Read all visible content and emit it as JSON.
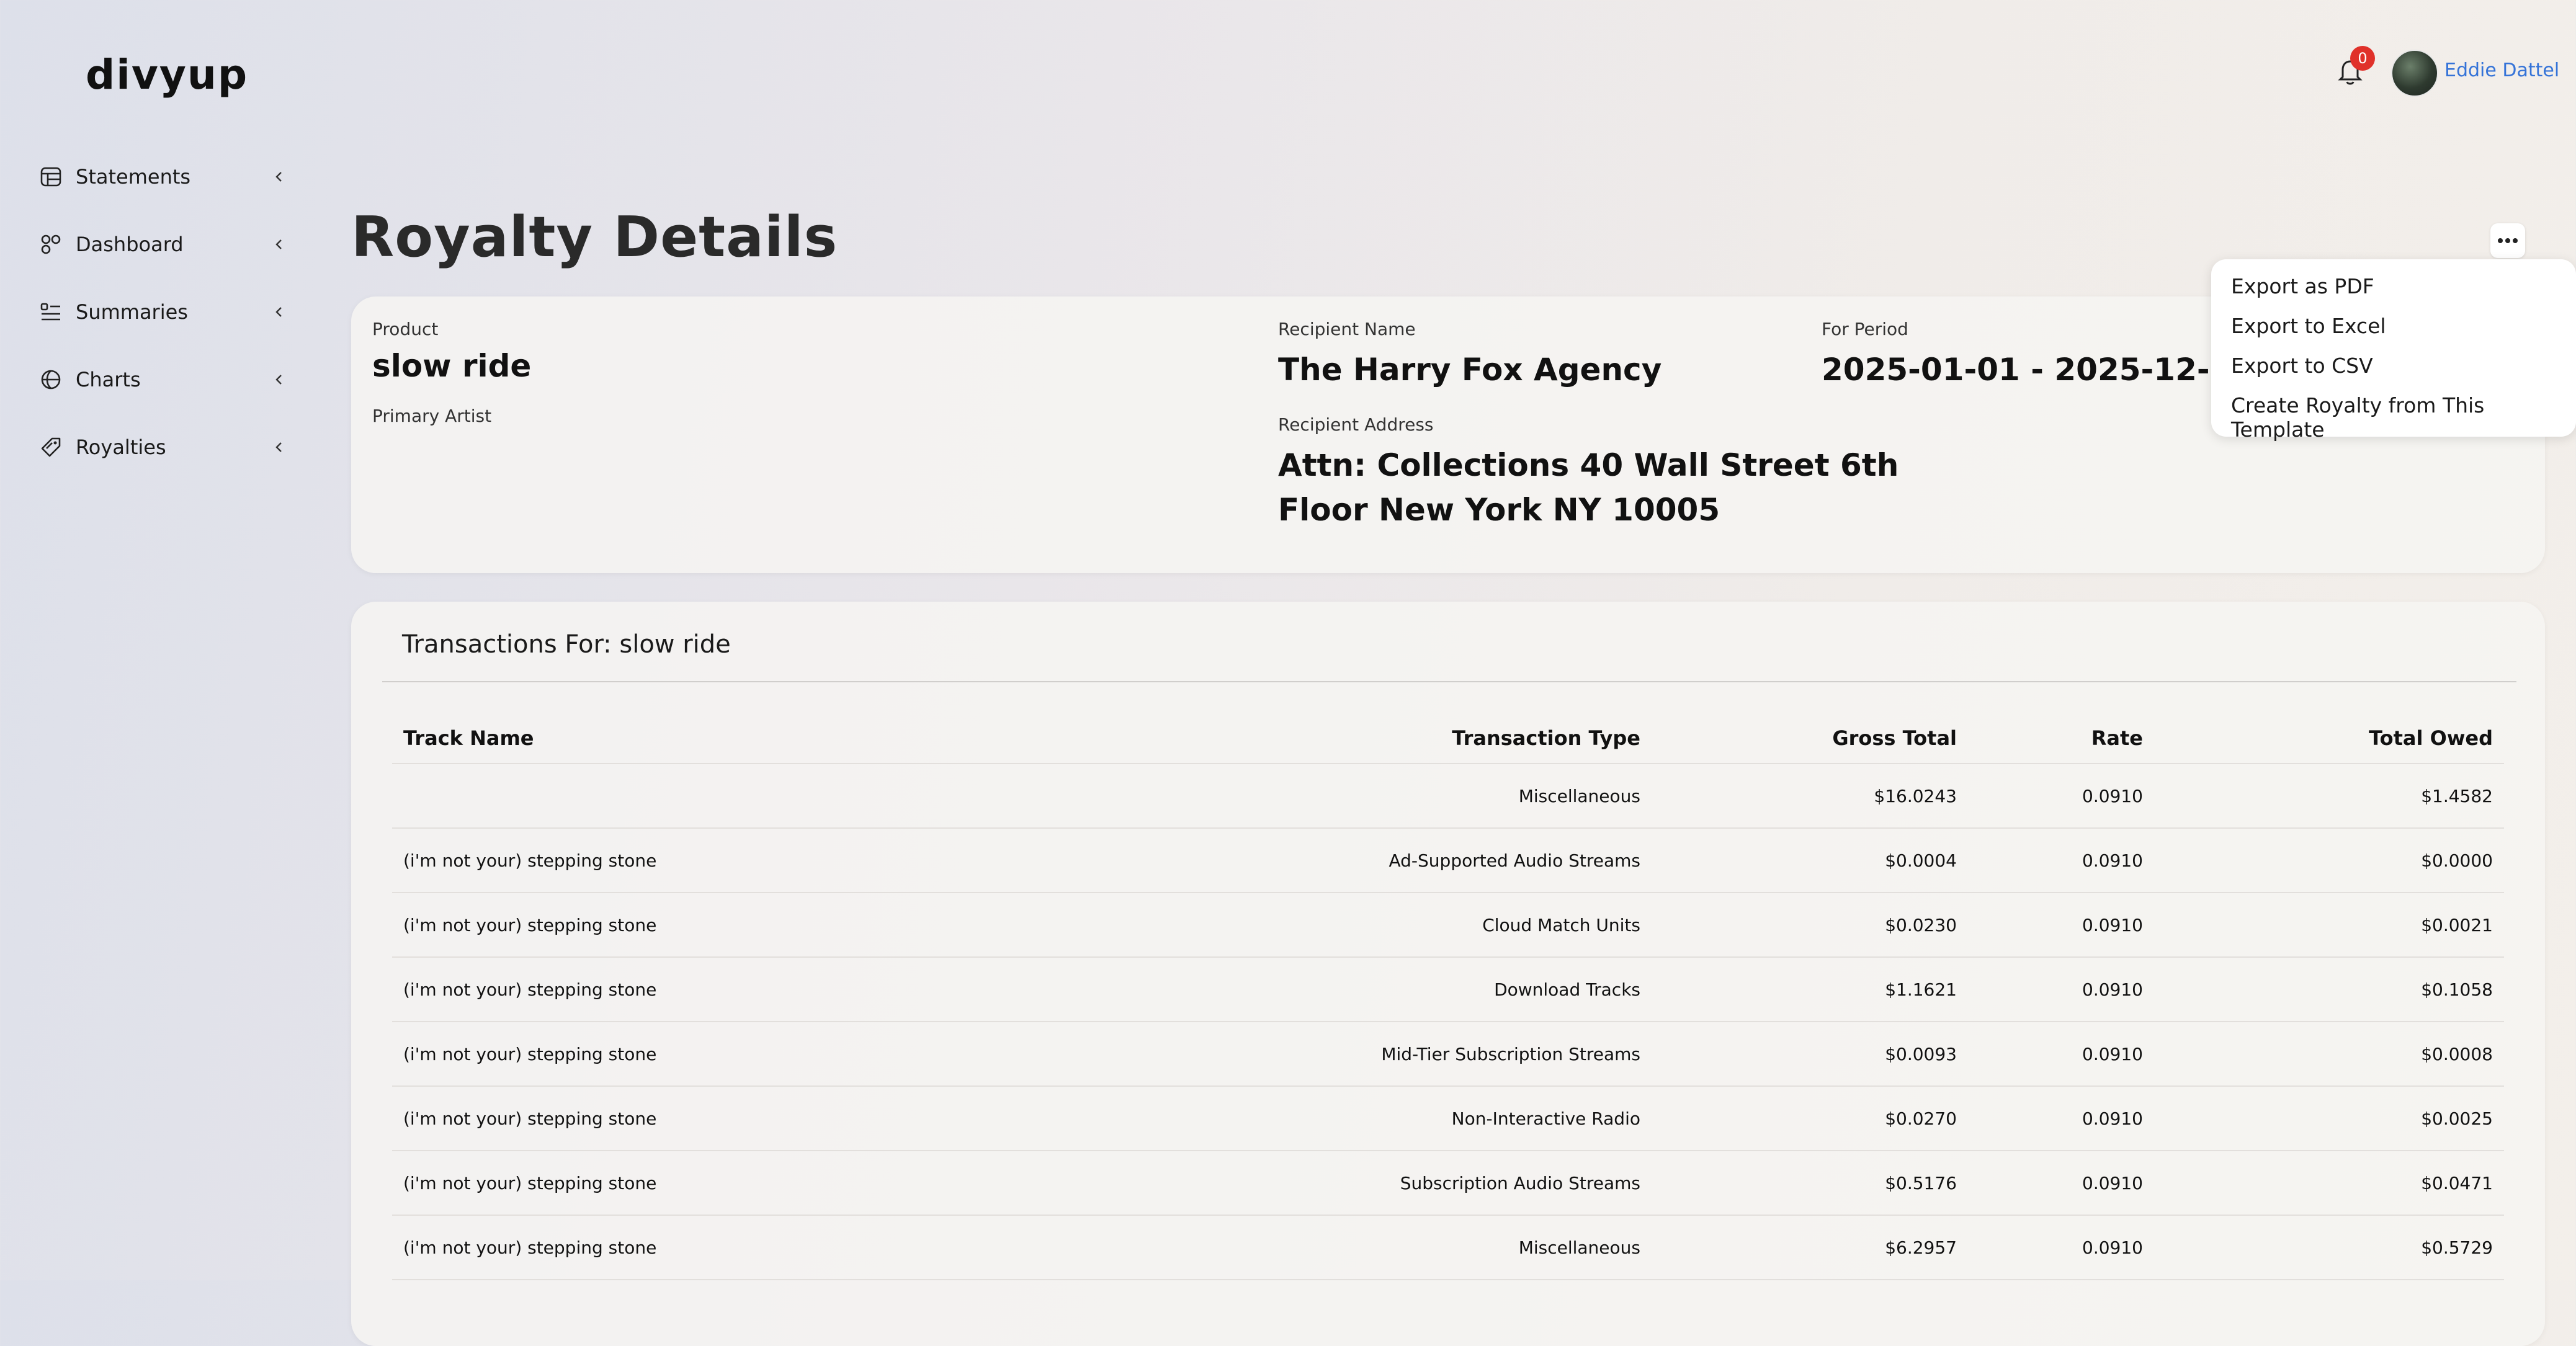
{
  "brand": {
    "logo": "divyup"
  },
  "sidebar": {
    "items": [
      {
        "label": "Statements",
        "icon": "table-icon"
      },
      {
        "label": "Dashboard",
        "icon": "dashboard-icon"
      },
      {
        "label": "Summaries",
        "icon": "list-icon"
      },
      {
        "label": "Charts",
        "icon": "globe-chart-icon"
      },
      {
        "label": "Royalties",
        "icon": "tag-icon"
      }
    ]
  },
  "header": {
    "notifications_count": "0",
    "user_name": "Eddie Dattel"
  },
  "page": {
    "title": "Royalty Details"
  },
  "menu": {
    "items": [
      "Export as PDF",
      "Export to Excel",
      "Export to CSV",
      "Create Royalty from This Template"
    ]
  },
  "details": {
    "product_label": "Product",
    "product_value": "slow ride",
    "primary_artist_label": "Primary Artist",
    "recipient_name_label": "Recipient Name",
    "recipient_name_value": "The Harry Fox Agency",
    "recipient_address_label": "Recipient Address",
    "recipient_address_line1": "Attn: Collections 40 Wall Street 6th",
    "recipient_address_line2": "Floor New York NY 10005",
    "period_label": "For Period",
    "period_value": "2025-01-01 - 2025-12-31"
  },
  "transactions": {
    "title": "Transactions For: slow ride",
    "columns": [
      "Track Name",
      "Transaction Type",
      "Gross Total",
      "Rate",
      "Total Owed"
    ],
    "rows": [
      [
        "",
        "Miscellaneous",
        "$16.0243",
        "0.0910",
        "$1.4582"
      ],
      [
        "(i'm not your) stepping stone",
        "Ad-Supported Audio Streams",
        "$0.0004",
        "0.0910",
        "$0.0000"
      ],
      [
        "(i'm not your) stepping stone",
        "Cloud Match Units",
        "$0.0230",
        "0.0910",
        "$0.0021"
      ],
      [
        "(i'm not your) stepping stone",
        "Download Tracks",
        "$1.1621",
        "0.0910",
        "$0.1058"
      ],
      [
        "(i'm not your) stepping stone",
        "Mid-Tier Subscription Streams",
        "$0.0093",
        "0.0910",
        "$0.0008"
      ],
      [
        "(i'm not your) stepping stone",
        "Non-Interactive Radio",
        "$0.0270",
        "0.0910",
        "$0.0025"
      ],
      [
        "(i'm not your) stepping stone",
        "Subscription Audio Streams",
        "$0.5176",
        "0.0910",
        "$0.0471"
      ],
      [
        "(i'm not your) stepping stone",
        "Miscellaneous",
        "$6.2957",
        "0.0910",
        "$0.5729"
      ]
    ]
  }
}
